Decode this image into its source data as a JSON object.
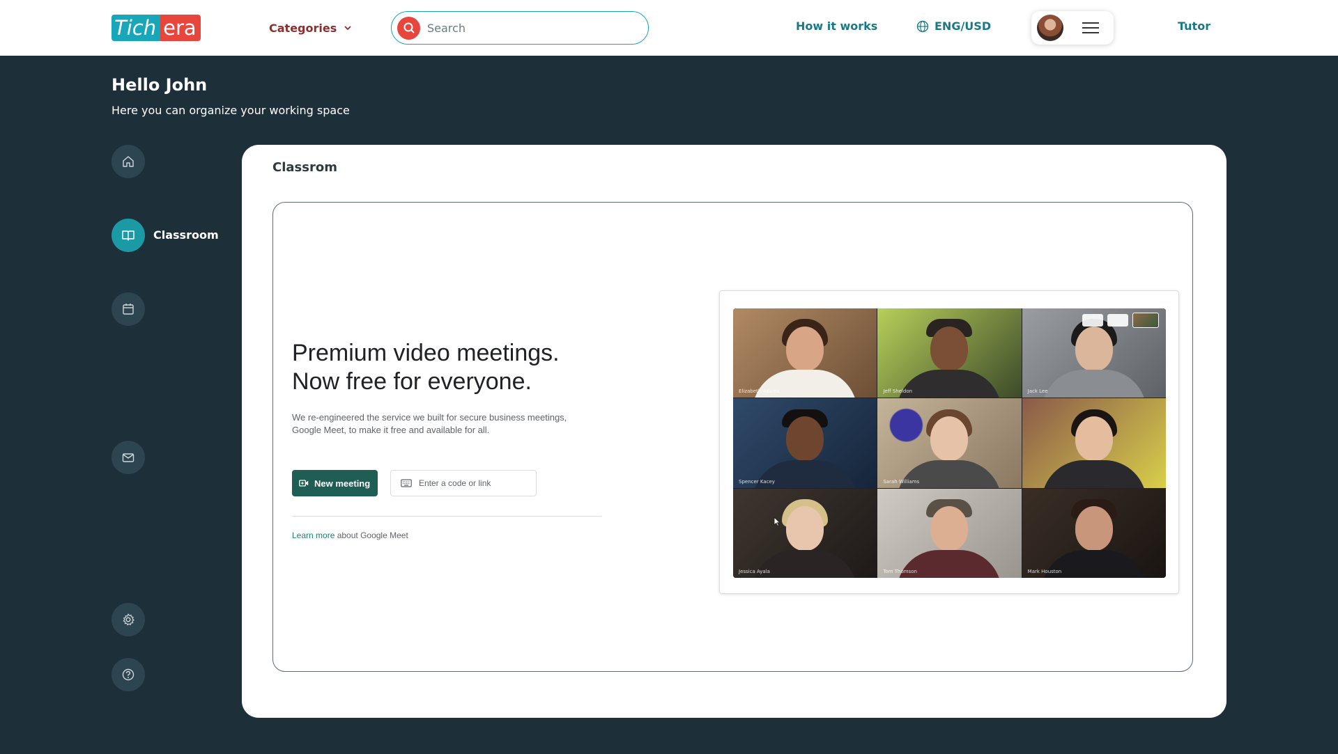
{
  "brand": {
    "logo_part1": "Tich",
    "logo_part2": "era"
  },
  "nav": {
    "categories_label": "Categories",
    "search_placeholder": "Search",
    "how_it_works": "How it works",
    "language": "ENG/USD",
    "tutor": "Tutor"
  },
  "greeting": {
    "title": "Hello John",
    "subtitle": "Here you can organize your working space"
  },
  "sidebar": {
    "items": [
      {
        "id": "home",
        "icon": "home-icon",
        "label": ""
      },
      {
        "id": "classroom",
        "icon": "book-icon",
        "label": "Classroom",
        "active": true
      },
      {
        "id": "calendar",
        "icon": "calendar-icon",
        "label": ""
      },
      {
        "id": "messages",
        "icon": "mail-icon",
        "label": ""
      },
      {
        "id": "settings",
        "icon": "gear-icon",
        "label": ""
      },
      {
        "id": "help",
        "icon": "help-icon",
        "label": ""
      }
    ]
  },
  "main": {
    "title": "Classrom",
    "meet": {
      "headline_line1": "Premium video meetings.",
      "headline_line2": "Now free for everyone.",
      "description": "We re-engineered the service we built for secure business meetings, Google Meet, to make it free and available for all.",
      "new_meeting_label": "New meeting",
      "code_placeholder": "Enter a code or link",
      "learn_more_link": "Learn more",
      "learn_more_suffix": " about Google Meet",
      "participants": [
        {
          "name": "Elizabeth Adams"
        },
        {
          "name": "Jeff Sheldon"
        },
        {
          "name": "Jack Lee"
        },
        {
          "name": "Spencer Kacey"
        },
        {
          "name": "Sarah Williams"
        },
        {
          "name": ""
        },
        {
          "name": "Jessica Ayala"
        },
        {
          "name": "Tom Thomson"
        },
        {
          "name": "Mark Houston"
        }
      ]
    }
  },
  "colors": {
    "background": "#1d2f38",
    "accent_teal": "#1b9aa6",
    "accent_red": "#e8453c",
    "meet_green": "#1f5e55"
  }
}
